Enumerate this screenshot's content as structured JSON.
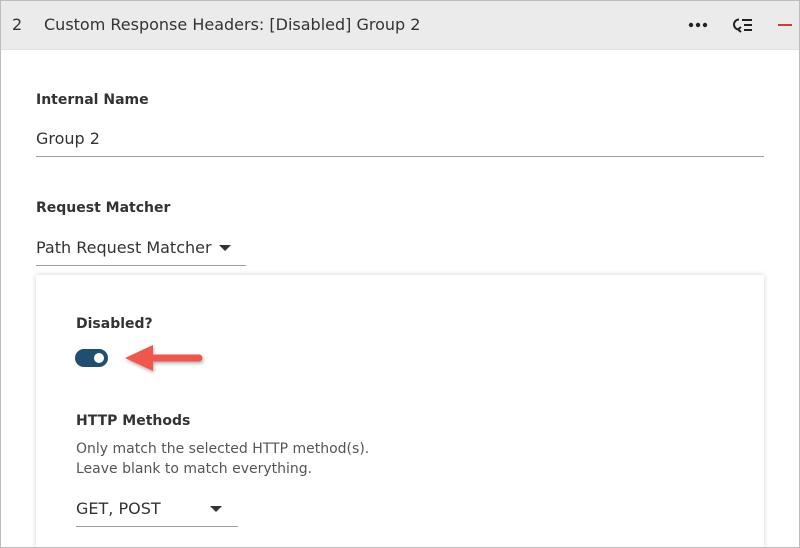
{
  "header": {
    "index": "2",
    "title": "Custom Response Headers: [Disabled] Group 2",
    "icons": [
      "more-icon",
      "list-icon",
      "minus-icon"
    ]
  },
  "internal_name": {
    "label": "Internal Name",
    "value": "Group 2"
  },
  "request_matcher": {
    "label": "Request Matcher",
    "selected": "Path Request Matcher"
  },
  "disabled": {
    "label": "Disabled?",
    "checked": true
  },
  "http_methods": {
    "label": "HTTP Methods",
    "help_line1": "Only match the selected HTTP method(s).",
    "help_line2": "Leave blank to match everything.",
    "selected": "GET, POST"
  },
  "colors": {
    "toggle_on": "#1f4f6f",
    "arrow": "#f0564a",
    "header_bg": "#ebebeb",
    "remove_accent": "#d9382c"
  }
}
